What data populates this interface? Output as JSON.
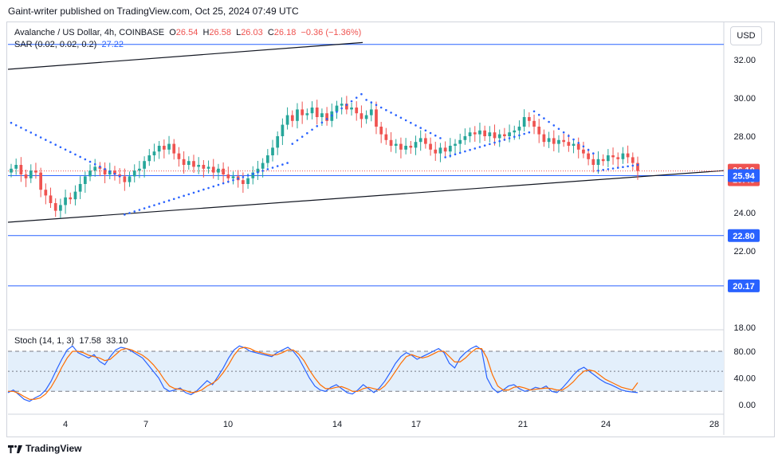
{
  "header": {
    "published": "Gaint-writer published on TradingView.com, Oct 25, 2024 07:49 UTC"
  },
  "legend": {
    "symbol": "Avalanche / US Dollar, 4h, COINBASE",
    "o_label": "O",
    "o_value": "26.54",
    "h_label": "H",
    "h_value": "26.58",
    "l_label": "L",
    "l_value": "26.03",
    "c_label": "C",
    "c_value": "26.18",
    "change": "−0.36 (−1.36%)",
    "sar_label": "SAR (0.02, 0.02, 0.2)",
    "sar_value": "27.22"
  },
  "currency_button": "USD",
  "stoch_legend": {
    "label": "Stoch (14, 1, 3)",
    "k_value": "17.58",
    "d_value": "33.10"
  },
  "brand": {
    "name": "TradingView"
  },
  "colors": {
    "up": "#26a69a",
    "down": "#ef5350",
    "sar": "#2962ff",
    "level_line": "#2962ff",
    "trendline": "#131722",
    "stoch_k": "#2962ff",
    "stoch_d": "#ff6d00",
    "stoch_band": "#e3effb"
  },
  "chart_data": [
    {
      "type": "candlestick",
      "title": "Avalanche / US Dollar, 4h, COINBASE",
      "ylim": [
        18,
        34
      ],
      "y_ticks": [
        "32.00",
        "30.00",
        "28.00",
        "24.00",
        "22.00",
        "18.00"
      ],
      "x_ticks": [
        "4",
        "7",
        "10",
        "14",
        "17",
        "21",
        "24",
        "28"
      ],
      "price_labels": [
        {
          "value": "26.18",
          "sub": "10:45",
          "color": "#ef5350"
        },
        {
          "value": "25.94",
          "color": "#2962ff"
        },
        {
          "value": "22.80",
          "color": "#2962ff"
        },
        {
          "value": "20.17",
          "color": "#2962ff"
        }
      ],
      "horizontal_levels": [
        32.8,
        22.8,
        20.17,
        25.94
      ],
      "current_price": 26.18,
      "trendlines": [
        {
          "from": [
            "Oct 1",
            31.5
          ],
          "to": [
            "Oct 14",
            32.9
          ]
        },
        {
          "from": [
            "Oct 1",
            23.5
          ],
          "to": [
            "Oct 28",
            26.2
          ]
        }
      ],
      "closes": [
        26.3,
        26.5,
        26.0,
        25.8,
        26.2,
        26.1,
        25.2,
        24.9,
        24.5,
        24.1,
        24.4,
        24.8,
        24.7,
        25.1,
        25.5,
        25.9,
        26.2,
        26.4,
        26.3,
        26.0,
        26.2,
        26.0,
        25.9,
        25.6,
        25.9,
        26.2,
        26.3,
        26.7,
        27.0,
        27.2,
        27.5,
        27.3,
        27.6,
        27.1,
        26.8,
        26.5,
        26.7,
        26.4,
        26.5,
        26.3,
        26.4,
        26.1,
        26.3,
        26.0,
        25.8,
        25.9,
        25.7,
        25.5,
        25.8,
        26.1,
        26.3,
        26.6,
        27.0,
        27.4,
        28.0,
        28.6,
        29.1,
        28.8,
        29.4,
        29.1,
        29.2,
        29.5,
        29.0,
        29.2,
        28.8,
        29.3,
        29.6,
        29.7,
        29.4,
        29.5,
        29.2,
        28.9,
        29.1,
        29.4,
        28.5,
        28.1,
        27.8,
        27.5,
        27.6,
        27.3,
        27.5,
        27.4,
        27.7,
        27.9,
        27.6,
        27.3,
        27.1,
        27.4,
        27.2,
        27.5,
        27.6,
        27.8,
        28.0,
        28.2,
        28.1,
        28.3,
        28.0,
        28.2,
        27.9,
        28.1,
        28.0,
        28.2,
        28.3,
        28.5,
        29.0,
        28.8,
        28.5,
        28.1,
        27.7,
        27.9,
        27.6,
        27.8,
        27.7,
        27.5,
        27.6,
        27.3,
        27.1,
        26.8,
        26.5,
        26.8,
        26.7,
        27.0,
        26.9,
        26.8,
        27.1,
        26.9,
        26.6,
        26.18
      ],
      "sar": [
        {
          "start": 0,
          "end": 23,
          "from": 28.7,
          "to": 25.9
        },
        {
          "start": 23,
          "end": 57,
          "from": 23.9,
          "to": 26.6
        },
        {
          "start": 57,
          "end": 72,
          "from": 27.6,
          "to": 30.2
        },
        {
          "start": 72,
          "end": 88,
          "from": 29.9,
          "to": 27.9
        },
        {
          "start": 88,
          "end": 106,
          "from": 26.9,
          "to": 28.2
        },
        {
          "start": 106,
          "end": 119,
          "from": 29.3,
          "to": 27.1
        },
        {
          "start": 119,
          "end": 128,
          "from": 26.2,
          "to": 26.5
        }
      ]
    },
    {
      "type": "line",
      "title": "Stoch (14, 1, 3)",
      "ylim": [
        0,
        100
      ],
      "y_ticks": [
        "80.00",
        "40.00",
        "0.00"
      ],
      "bands": [
        20,
        50,
        80
      ],
      "series": [
        {
          "name": "17.58",
          "color": "#2962ff",
          "values": [
            18,
            22,
            15,
            8,
            5,
            10,
            14,
            22,
            35,
            52,
            68,
            82,
            88,
            78,
            74,
            70,
            75,
            65,
            60,
            72,
            82,
            86,
            84,
            80,
            75,
            70,
            60,
            50,
            40,
            25,
            20,
            22,
            25,
            18,
            15,
            20,
            28,
            36,
            30,
            42,
            55,
            70,
            82,
            88,
            85,
            80,
            78,
            76,
            74,
            72,
            78,
            82,
            86,
            80,
            70,
            55,
            40,
            28,
            22,
            20,
            26,
            30,
            24,
            18,
            16,
            22,
            30,
            24,
            18,
            25,
            35,
            48,
            62,
            72,
            78,
            74,
            68,
            72,
            76,
            80,
            84,
            78,
            62,
            55,
            70,
            78,
            84,
            88,
            82,
            40,
            25,
            18,
            22,
            28,
            30,
            24,
            20,
            22,
            26,
            24,
            28,
            20,
            18,
            25,
            34,
            44,
            52,
            56,
            50,
            44,
            38,
            33,
            30,
            26,
            22,
            20,
            19,
            18
          ]
        },
        {
          "name": "33.10",
          "color": "#ff6d00",
          "values": [
            20,
            20,
            17,
            12,
            8,
            8,
            10,
            16,
            26,
            40,
            56,
            70,
            80,
            80,
            78,
            74,
            72,
            70,
            66,
            68,
            75,
            82,
            84,
            82,
            78,
            74,
            68,
            60,
            50,
            38,
            28,
            24,
            23,
            21,
            18,
            19,
            22,
            28,
            32,
            38,
            48,
            60,
            74,
            84,
            86,
            84,
            80,
            78,
            76,
            74,
            75,
            78,
            82,
            82,
            76,
            66,
            52,
            40,
            30,
            24,
            24,
            26,
            27,
            24,
            20,
            20,
            24,
            26,
            24,
            22,
            28,
            38,
            50,
            62,
            72,
            75,
            72,
            70,
            72,
            76,
            80,
            80,
            72,
            64,
            64,
            70,
            78,
            84,
            84,
            70,
            45,
            28,
            22,
            22,
            26,
            27,
            25,
            22,
            23,
            24,
            25,
            24,
            22,
            22,
            27,
            34,
            43,
            50,
            52,
            50,
            44,
            38,
            34,
            30,
            26,
            24,
            22,
            33
          ]
        }
      ]
    }
  ]
}
